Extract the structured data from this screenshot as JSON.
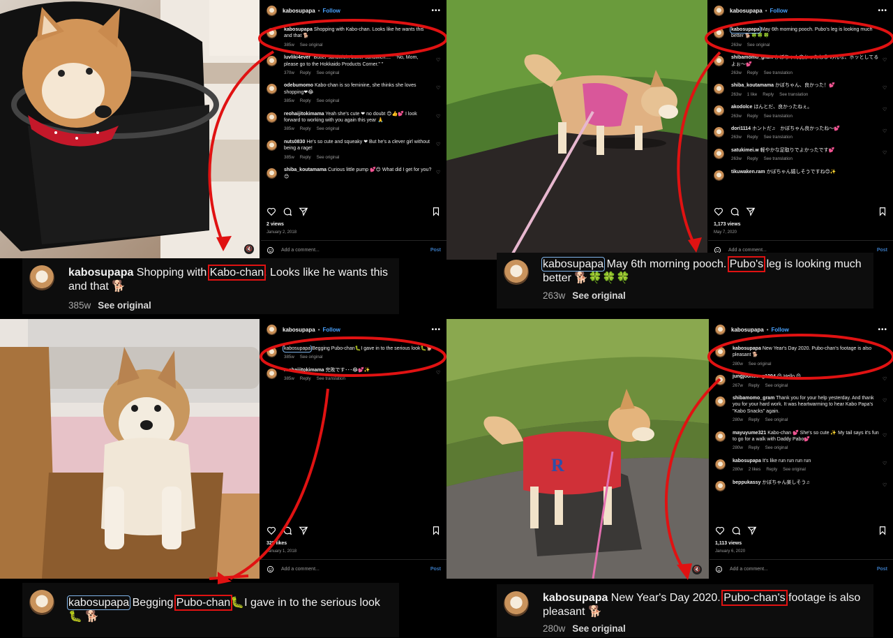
{
  "panels": [
    {
      "username": "kabosupapa",
      "follow_label": "Follow",
      "caption_text": "Shopping with Kabo-chan. Looks like he wants this and that 🐕",
      "caption_age": "385w",
      "see_original": "See original",
      "comments": [
        {
          "user": "luvliki4ever",
          "text": "\"Butter sandwich, butter sandwich.... \" \"No, Mom, please go to the Hokkaido Products Corner.\" \"",
          "age": "370w",
          "reply": "Reply",
          "action": "See original"
        },
        {
          "user": "odebumomo",
          "text": "Kabo-chan is so feminine, she thinks she loves shopping❤😂",
          "age": "385w",
          "reply": "Reply",
          "action": "See original"
        },
        {
          "user": "reohaijitokimama",
          "text": "Yeah she's cute ❤ no doubt 😊👍💕 I look forward to working with you again this year 🙏",
          "age": "385w",
          "reply": "Reply",
          "action": "See original"
        },
        {
          "user": "nuts0830",
          "text": "He's so cute and squeaky ❤ But he's a clever girl without being a rage!",
          "age": "385w",
          "reply": "Reply",
          "action": "See original"
        },
        {
          "user": "shiba_koutamama",
          "text": "Curious little pump 💕😊 What did I get for you? 😊",
          "age": "",
          "reply": "",
          "action": ""
        }
      ],
      "stats": "2 views",
      "date": "January 2, 2018",
      "add_comment": "Add a comment...",
      "post_label": "Post",
      "big_caption": {
        "user": "kabosupapa",
        "pre": " Shopping with ",
        "highlight": "Kabo-chan",
        "post": ". Looks like he wants this and that 🐕",
        "age": "385w",
        "see_original": "See original"
      }
    },
    {
      "username": "kabosupapa",
      "follow_label": "Follow",
      "caption_text": "May 6th morning pooch. Pubo's leg is looking much better 🐕🍀🍀🍀",
      "caption_age": "263w",
      "see_original": "See original",
      "comments": [
        {
          "user": "shibamomo_gram",
          "text": "かぼちゃん良かったね😊 みんな、ホッとしてるよぉ〜💕",
          "age": "263w",
          "reply": "Reply",
          "action": "See translation"
        },
        {
          "user": "shiba_koutamama",
          "text": "かぼちゃん、良かった！💕",
          "age": "263w",
          "likes": "1 like",
          "reply": "Reply",
          "action": "See translation"
        },
        {
          "user": "akodolce",
          "text": "ほんとだ、良かったねぇ。",
          "age": "263w",
          "reply": "Reply",
          "action": "See translation"
        },
        {
          "user": "dori1114",
          "text": "ホントだ♫　かぼちゃん良かったね〜💕",
          "age": "263w",
          "reply": "Reply",
          "action": "See translation"
        },
        {
          "user": "satukimei.w",
          "text": "軽やかな足取りでよかったです💕",
          "age": "263w",
          "reply": "Reply",
          "action": "See translation"
        },
        {
          "user": "tikuwaken.ram",
          "text": "かぼちゃん嬉しそうですね😊✨",
          "age": "",
          "reply": "",
          "action": ""
        }
      ],
      "stats": "1,173 views",
      "date": "May 7, 2020",
      "add_comment": "Add a comment...",
      "post_label": "Post",
      "big_caption": {
        "user": "kabosupapa",
        "pre": " May 6th morning pooch. ",
        "highlight": "Pubo's",
        "post": " leg is looking much better 🐕🍀🍀🍀",
        "age": "263w",
        "see_original": "See original"
      }
    },
    {
      "username": "kabosupapa",
      "follow_label": "Follow",
      "caption_text": "Begging Pubo-chan🐛I gave in to the serious look🐛🐕",
      "caption_age": "385w",
      "see_original": "See original",
      "comments": [
        {
          "user": "reohaijitokimama",
          "text": "完敗です･･･😂💕✨",
          "age": "385w",
          "reply": "Reply",
          "action": "See translation"
        }
      ],
      "stats": "328 likes",
      "date": "January 1, 2018",
      "add_comment": "Add a comment...",
      "post_label": "Post",
      "big_caption": {
        "user": "kabosupapa",
        "pre": " Begging ",
        "highlight": "Pubo-chan",
        "post": "🐛I gave in to the serious look🐛 🐕",
        "age": "",
        "see_original": ""
      }
    },
    {
      "username": "kabosupapa",
      "follow_label": "Follow",
      "caption_text": "New Year's Day 2020. Pubo-chan's footage is also pleasant 🐕",
      "caption_age": "280w",
      "see_original": "See original",
      "comments": [
        {
          "user": "jungjoonsung1994",
          "text": "😍 Hello 😍",
          "age": "267w",
          "reply": "Reply",
          "action": "See original"
        },
        {
          "user": "shibamomo_gram",
          "text": "Thank you for your help yesterday. And thank you for your hard work. It was heartwarming to hear Kabo Papa's \"Kabo Snacks\" again.",
          "age": "280w",
          "reply": "Reply",
          "action": "See original"
        },
        {
          "user": "mayuyume321",
          "text": "Kabo-chan 💕 She's so cute ✨ My tail says it's fun to go for a walk with Daddy Pabo💕",
          "age": "280w",
          "reply": "Reply",
          "action": "See original"
        },
        {
          "user": "kabosupapa",
          "text": "It's like run run run run",
          "age": "280w",
          "likes": "2 likes",
          "reply": "Reply",
          "action": "See original"
        },
        {
          "user": "beppukassy",
          "text": "かぼちゃん楽しそう♫",
          "age": "",
          "reply": "",
          "action": ""
        }
      ],
      "stats": "1,113 views",
      "date": "January 6, 2020",
      "add_comment": "Add a comment...",
      "post_label": "Post",
      "big_caption": {
        "user": "kabosupapa",
        "pre": " New Year's Day 2020. ",
        "highlight": "Pubo-chan's",
        "post": " footage is also pleasant 🐕",
        "age": "280w",
        "see_original": "See original"
      }
    }
  ],
  "colors": {
    "annotation_red": "#e01212",
    "username_box_blue": "#7fb4ea",
    "link_blue": "#4aa3ff"
  }
}
